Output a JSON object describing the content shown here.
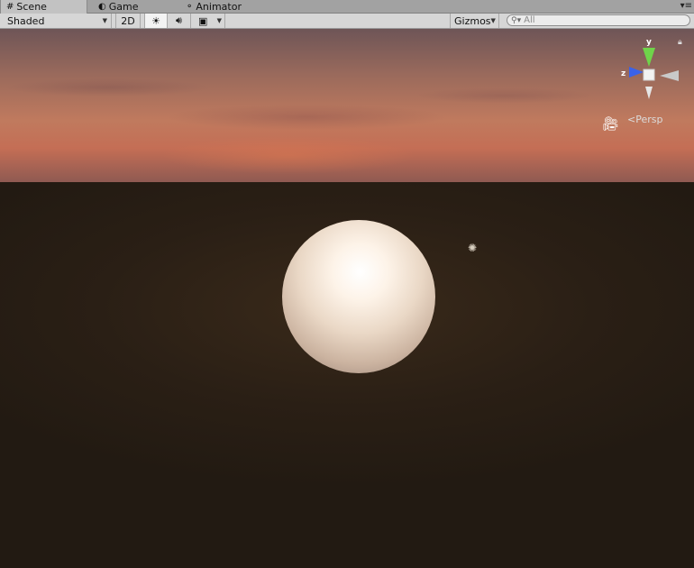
{
  "tabs": [
    {
      "label": "Scene",
      "icon": "hash-icon",
      "active": true
    },
    {
      "label": "Game",
      "icon": "pacman-icon",
      "active": false
    },
    {
      "label": "Animator",
      "icon": "animator-icon",
      "active": false
    }
  ],
  "toolbar": {
    "shading_mode": "Shaded",
    "mode_2d": "2D",
    "gizmos_label": "Gizmos",
    "search_placeholder": "All"
  },
  "scene": {
    "projection": "Persp",
    "axes": {
      "y": "y",
      "z": "z"
    }
  },
  "colors": {
    "sky_top": "#6e5557",
    "sky_horizon": "#c46e55",
    "ground": "#2a1f15",
    "axis_y": "#6fd44a",
    "axis_z": "#3a62e8",
    "axis_x": "#e3e3e3"
  }
}
